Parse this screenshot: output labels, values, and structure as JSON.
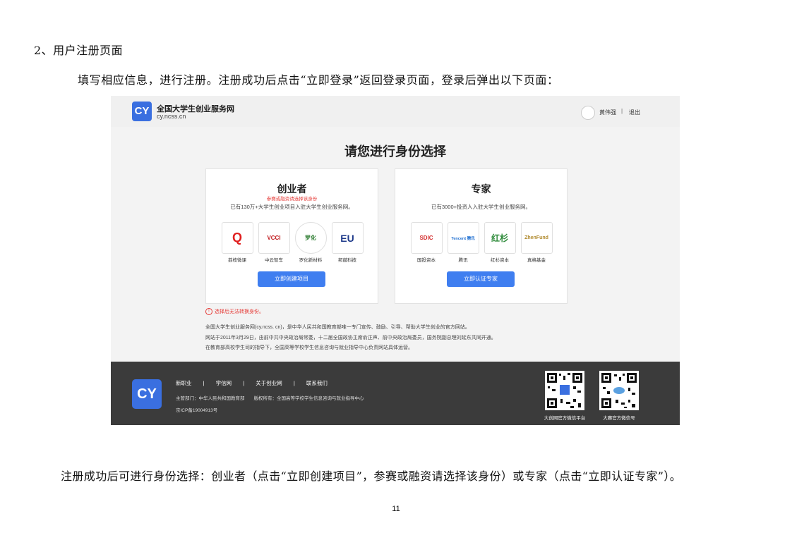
{
  "doc": {
    "heading": "2、用户注册页面",
    "intro": "填写相应信息，进行注册。注册成功后点击“立即登录”返回登录页面，登录后弹出以下页面：",
    "summary": "注册成功后可进行身份选择：创业者（点击“立即创建项目”，参赛或融资请选择该身份）或专家（点击“立即认证专家”）。",
    "page_number": "11"
  },
  "screenshot": {
    "header": {
      "logo_text": "CY",
      "site_name": "全国大学生创业服务网",
      "site_domain": "cy.ncss.cn",
      "user_name": "黄伟强",
      "separator": "|",
      "logout": "退出"
    },
    "title": "请您进行身份选择",
    "entrepreneur": {
      "title": "创业者",
      "note": "参赛或融资请选择该身份",
      "desc": "已有130万+大学生创业项目入驻大学生创业服务网。",
      "logos": [
        {
          "label": "荔枝微课",
          "mark": "Q",
          "color": "#e02020"
        },
        {
          "label": "中云智车",
          "mark": "VCCI",
          "color": "#c0181c"
        },
        {
          "label": "罗化新材料",
          "mark": "罗化",
          "color": "#2e7d32"
        },
        {
          "label": "邦鼓科技",
          "mark": "EU",
          "color": "#1e3a8a"
        }
      ],
      "button": "立即创建项目"
    },
    "expert": {
      "title": "专家",
      "desc": "已有3000+投资人入驻大学生创业服务网。",
      "logos": [
        {
          "label": "国投资本",
          "mark": "SDIC",
          "color": "#d32f2f"
        },
        {
          "label": "腾讯",
          "mark": "Tencent 腾讯",
          "color": "#1f6fd1"
        },
        {
          "label": "红杉资本",
          "mark": "红杉",
          "color": "#2e8b3a"
        },
        {
          "label": "真格基金",
          "mark": "ZhenFund",
          "color": "#b08a2e"
        }
      ],
      "button": "立即认证专家"
    },
    "warning": "选择后无法转换身份。",
    "about": [
      "全国大学生创业服务网(cy.ncss. cn)，是中华人民共和国教育部唯一专门宣传、鼓励、引导、帮助大学生创业的官方网站。",
      "网站于2011年3月29日，由前中共中央政治局常委，十二届全国政协主席俞正声、前中央政治局委员，国务院副总理刘延东共同开通。",
      "在教育部高校学生司的指导下，全国高等学校学生信息咨询与就业指导中心负责网站具体运营。"
    ],
    "footer": {
      "logo_text": "CY",
      "links": [
        "新职业",
        "|",
        "学信网",
        "|",
        "关于创业网",
        "|",
        "联系我们"
      ],
      "info": "主管部门：中华人民共和国教育部　　版权所有：全国高等学校学生信息咨询与就业指导中心",
      "icp": "京ICP备19004913号",
      "qr_caption_1": "大创网官方微信平台",
      "qr_caption_2": "大赛官方微信号"
    }
  }
}
